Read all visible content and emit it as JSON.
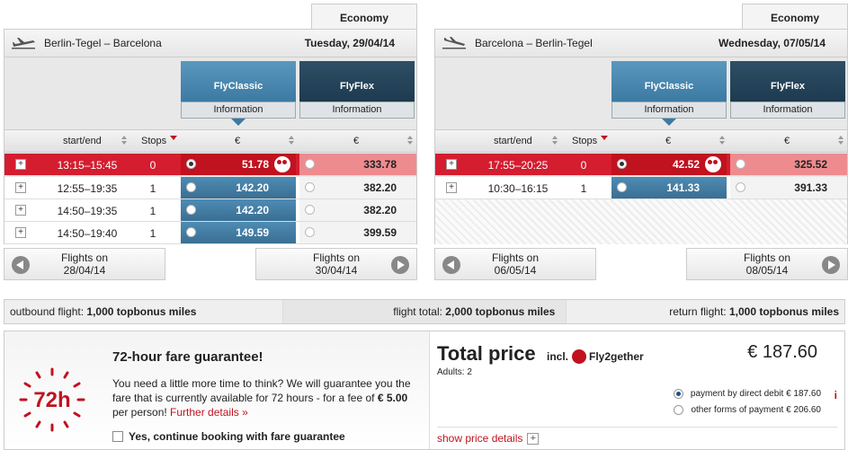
{
  "cabin": "Economy",
  "outbound": {
    "route": "Berlin-Tegel – Barcelona",
    "date": "Tuesday, 29/04/14",
    "fare1": {
      "name": "FlyClassic",
      "info": "Information"
    },
    "fare2": {
      "name": "FlyFlex",
      "info": "Information"
    },
    "headers": {
      "time": "start/end",
      "stops": "Stops",
      "cur1": "€",
      "cur2": "€"
    },
    "rows": [
      {
        "time": "13:15–15:45",
        "stops": "0",
        "price1": "51.78",
        "price2": "333.78"
      },
      {
        "time": "12:55–19:35",
        "stops": "1",
        "price1": "142.20",
        "price2": "382.20"
      },
      {
        "time": "14:50–19:35",
        "stops": "1",
        "price1": "142.20",
        "price2": "382.20"
      },
      {
        "time": "14:50–19:40",
        "stops": "1",
        "price1": "149.59",
        "price2": "399.59"
      }
    ],
    "prev": {
      "label": "Flights on",
      "date": "28/04/14"
    },
    "next": {
      "label": "Flights on",
      "date": "30/04/14"
    }
  },
  "inbound": {
    "route": "Barcelona – Berlin-Tegel",
    "date": "Wednesday, 07/05/14",
    "fare1": {
      "name": "FlyClassic",
      "info": "Information"
    },
    "fare2": {
      "name": "FlyFlex",
      "info": "Information"
    },
    "headers": {
      "time": "start/end",
      "stops": "Stops",
      "cur1": "€",
      "cur2": "€"
    },
    "rows": [
      {
        "time": "17:55–20:25",
        "stops": "0",
        "price1": "42.52",
        "price2": "325.52"
      },
      {
        "time": "10:30–16:15",
        "stops": "1",
        "price1": "141.33",
        "price2": "391.33"
      }
    ],
    "prev": {
      "label": "Flights on",
      "date": "06/05/14"
    },
    "next": {
      "label": "Flights on",
      "date": "08/05/14"
    }
  },
  "miles": {
    "outbound_label": "outbound flight:",
    "outbound_value": "1,000 topbonus miles",
    "total_label": "flight total:",
    "total_value": "2,000 topbonus miles",
    "return_label": "return flight:",
    "return_value": "1,000 topbonus miles"
  },
  "guarantee": {
    "badge": "72h",
    "title": "72-hour fare guarantee!",
    "text": "You need a little more time to think? We will guarantee you the fare that is currently available for 72 hours - for a fee of ",
    "fee": "€ 5.00",
    "text2": " per person! ",
    "link": "Further details »",
    "checkbox": "Yes, continue booking with fare guarantee"
  },
  "total": {
    "title": "Total price",
    "incl": "incl.",
    "brand": "Fly2gether",
    "amount": "€ 187.60",
    "adults": "Adults: 2",
    "pay1": "payment by direct debit € 187.60",
    "pay2": "other forms of payment € 206.60",
    "info": "i",
    "details": "show price details",
    "plus": "+"
  }
}
